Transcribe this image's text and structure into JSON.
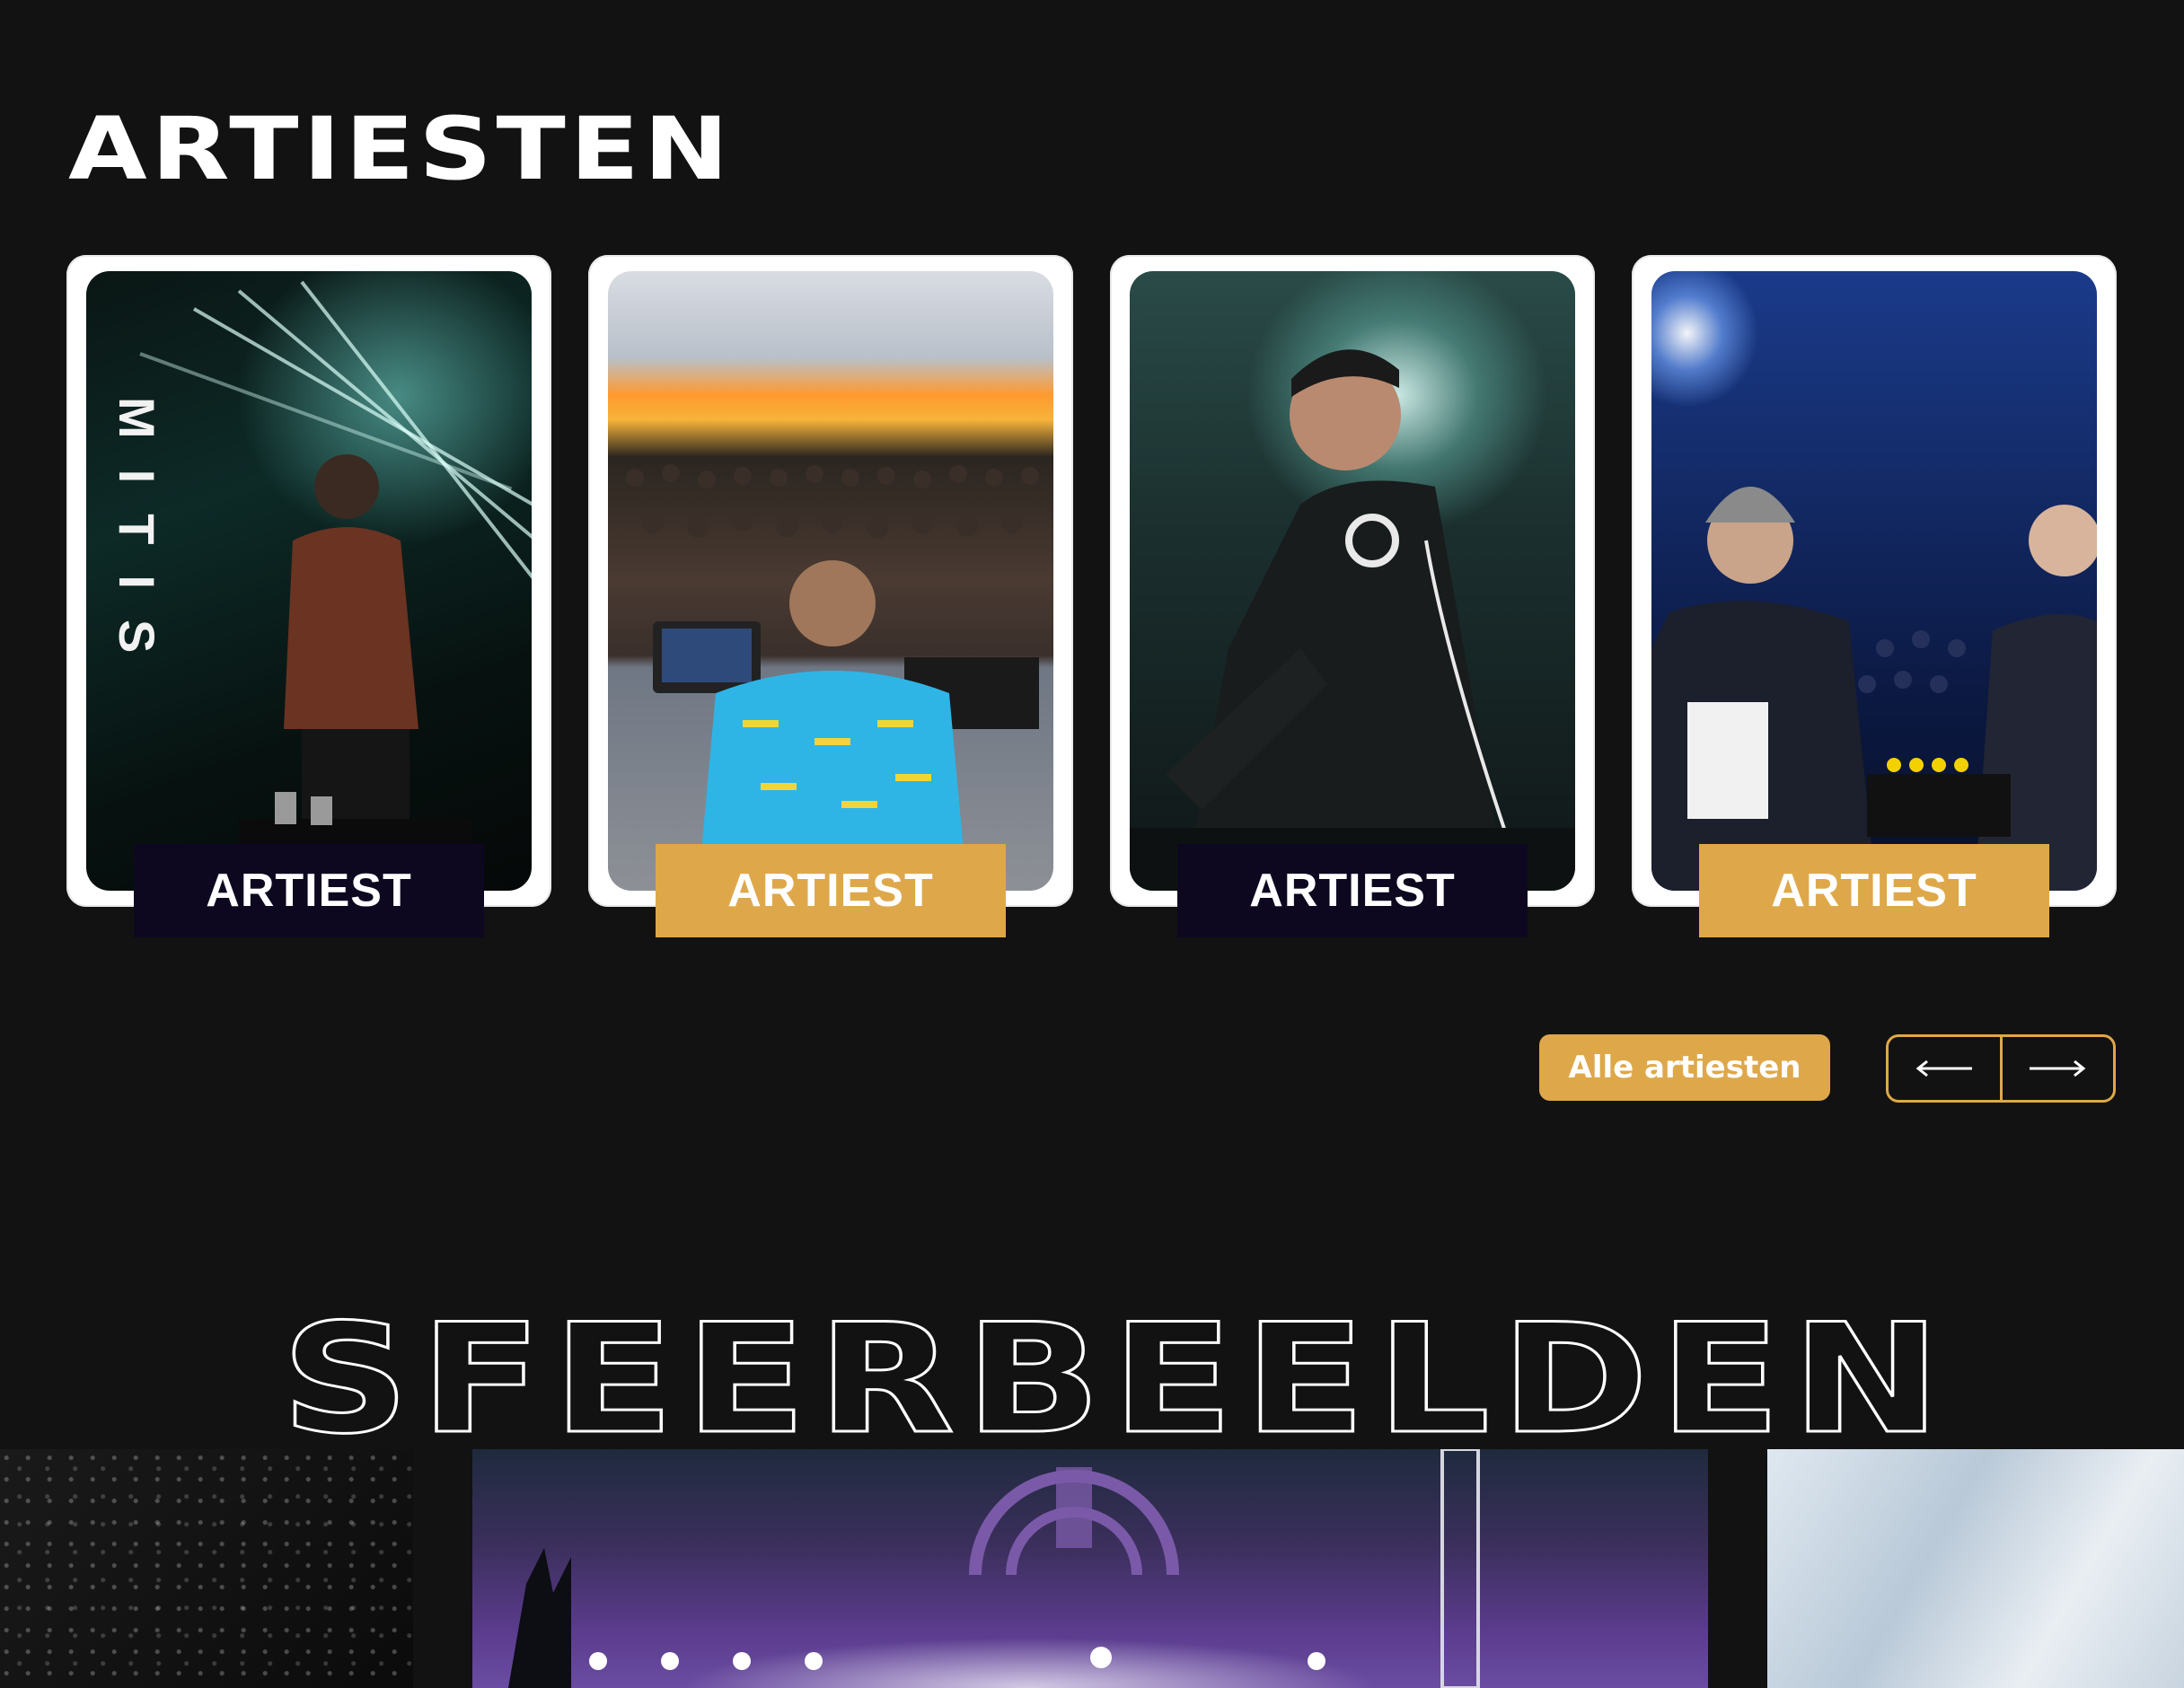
{
  "artists_section": {
    "title": "ARTIESTEN",
    "cards": [
      {
        "label": "ARTIEST",
        "label_style": "dark",
        "photo_text": "MITIS"
      },
      {
        "label": "ARTIEST",
        "label_style": "gold"
      },
      {
        "label": "ARTIEST",
        "label_style": "dark"
      },
      {
        "label": "ARTIEST",
        "label_style": "gold"
      }
    ],
    "all_button_label": "Alle artiesten",
    "prev_icon": "arrow-left-icon",
    "next_icon": "arrow-right-icon"
  },
  "gallery_section": {
    "title": "SFEERBEELDEN"
  },
  "colors": {
    "background": "#121212",
    "accent_gold": "#dea84a",
    "label_dark": "#0d0820",
    "text": "#ffffff"
  }
}
